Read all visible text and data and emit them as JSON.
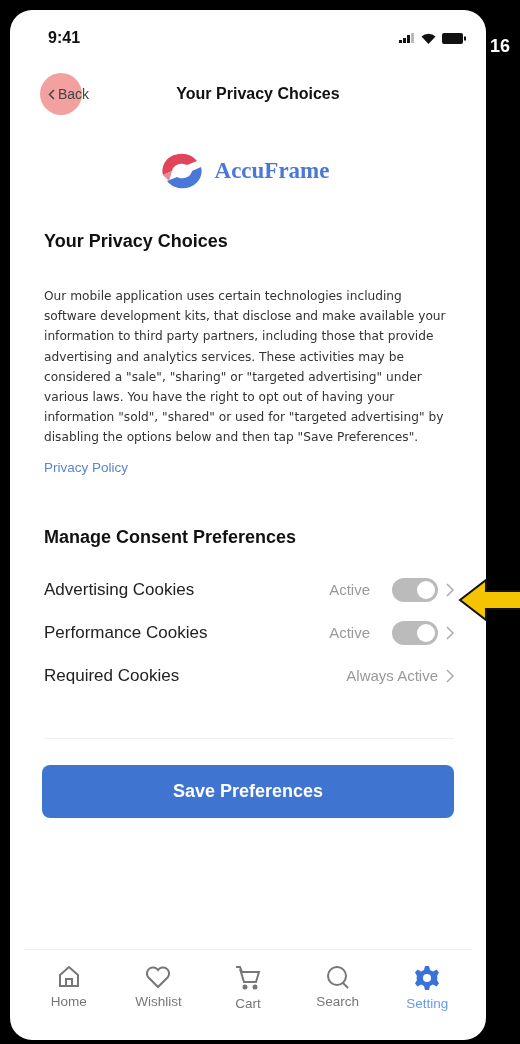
{
  "status_bar": {
    "time": "9:41"
  },
  "side_label": "16",
  "nav": {
    "back": "Back",
    "title": "Your Privacy Choices",
    "touch_indicator": true
  },
  "logo": {
    "name": "AccuFrame"
  },
  "heading": "Your Privacy Choices",
  "body": "Our mobile application uses certain technologies including software development kits, that disclose and make available your information to third party partners, including those that provide advertising and analytics services. These activities may be considered a \"sale\", \"sharing\" or \"targeted advertising\" under various laws. You have the right to opt out of having your information \"sold\", \"shared\" or used for \"targeted advertising\" by disabling the options below and then tap \"Save Preferences\".",
  "privacy_link": "Privacy Policy",
  "consent": {
    "title": "Manage Consent Preferences",
    "items": [
      {
        "label": "Advertising Cookies",
        "status": "Active",
        "kind": "toggle",
        "on": true,
        "highlighted": true
      },
      {
        "label": "Performance Cookies",
        "status": "Active",
        "kind": "toggle",
        "on": true,
        "highlighted": false
      },
      {
        "label": "Required Cookies",
        "status": "Always Active",
        "kind": "fixed"
      }
    ]
  },
  "save_button": "Save Preferences",
  "tabs": [
    {
      "label": "Home",
      "selected": false
    },
    {
      "label": "Wishlist",
      "selected": false
    },
    {
      "label": "Cart",
      "selected": false
    },
    {
      "label": "Search",
      "selected": false
    },
    {
      "label": "Setting",
      "selected": true
    }
  ]
}
